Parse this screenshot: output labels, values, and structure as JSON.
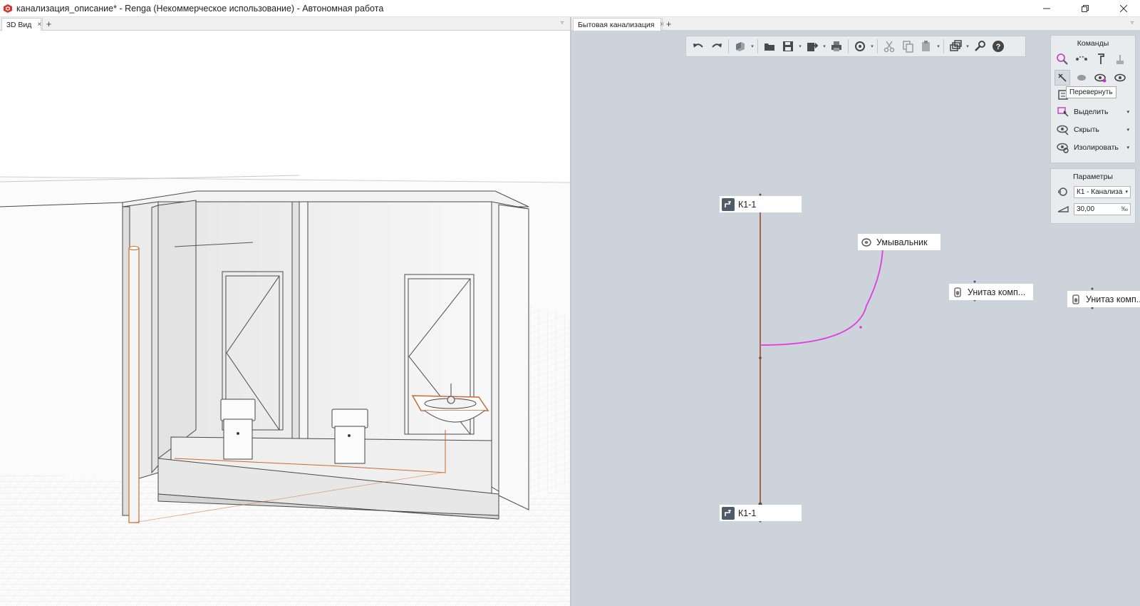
{
  "window": {
    "title": "канализация_описание* - Renga (Некоммерческое использование) - Автономная работа",
    "buttons": [
      "minimize-icon",
      "restore-icon",
      "close-icon"
    ]
  },
  "left_pane": {
    "tab_label": "3D Вид",
    "close_glyph": "×",
    "add_glyph": "+",
    "menu_glyph": "▿",
    "scene_icons": [
      "building-section-3d",
      "toilet-3d",
      "washbasin-3d",
      "riser-pipe-3d"
    ]
  },
  "right_pane": {
    "tab_label": "Бытовая канализация",
    "close_glyph": "×",
    "add_glyph": "+",
    "menu_glyph": "▿",
    "toolbar_icons": [
      "undo-icon",
      "redo-icon",
      "model-view-icon",
      "open-folder-icon",
      "save-icon",
      "export-icon",
      "print-icon",
      "sync-icon",
      "cut-icon",
      "copy-icon",
      "paste-icon",
      "layers-icon",
      "settings-wrench-icon",
      "help-icon"
    ],
    "commands_panel": {
      "title": "Команды",
      "icon_rows": [
        [
          "zoom-icon",
          "connect-icon",
          "riser-icon",
          "fixture-icon"
        ],
        [
          "flip-icon",
          "node-icon",
          "show-icon",
          "eye-icon"
        ]
      ],
      "tooltip": "Перевернуть",
      "items": [
        {
          "label": "Выделить",
          "icon": "select-icon",
          "arrow": "▾"
        },
        {
          "label": "Скрыть",
          "icon": "hide-icon",
          "arrow": "▾"
        },
        {
          "label": "Изолировать",
          "icon": "isolate-icon",
          "arrow": "▾"
        }
      ]
    },
    "params_panel": {
      "title": "Параметры",
      "system_value": "К1 - Канализа",
      "slope_value": "30,00",
      "slope_unit": "‰"
    },
    "nodes": {
      "top_riser": "К1-1",
      "bottom_riser": "К1-1",
      "washbasin": "Умывальник",
      "toilet_1": "Унитаз комп...",
      "toilet_2": "Унитаз комп..."
    },
    "colors": {
      "riser_line": "#9a4a24",
      "branch_line": "#e43be0",
      "background": "#ccd3da"
    }
  }
}
